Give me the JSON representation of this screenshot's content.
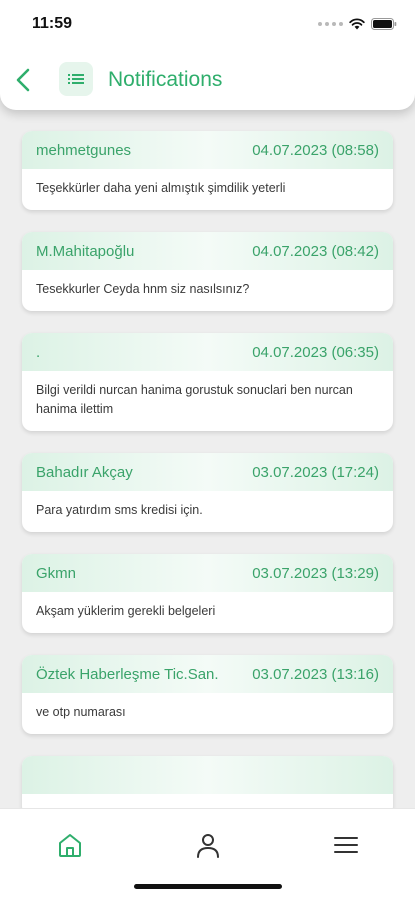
{
  "status_bar": {
    "time": "11:59"
  },
  "header": {
    "title": "Notifications"
  },
  "notifications": [
    {
      "sender": "mehmetgunes",
      "date": "04.07.2023 (08:58)",
      "message": "Teşekkürler daha yeni almıştık şimdilik yeterli"
    },
    {
      "sender": "M.Mahitapoğlu",
      "date": "04.07.2023 (08:42)",
      "message": "Tesekkurler Ceyda hnm siz nasılsınız?"
    },
    {
      "sender": ".",
      "date": "04.07.2023 (06:35)",
      "message": "Bilgi verildi nurcan hanima gorustuk sonuclari ben nurcan hanima ilettim"
    },
    {
      "sender": "Bahadır Akçay",
      "date": "03.07.2023 (17:24)",
      "message": "Para yatırdım sms kredisi için."
    },
    {
      "sender": "Gkmn",
      "date": "03.07.2023 (13:29)",
      "message": "Akşam yüklerim gerekli belgeleri"
    },
    {
      "sender": "Öztek Haberleşme Tic.San.",
      "date": "03.07.2023 (13:16)",
      "message": "ve otp numarası"
    },
    {
      "sender": "",
      "date": "",
      "message": ""
    }
  ],
  "nav": {
    "active": "home"
  },
  "colors": {
    "accent": "#2fae6c",
    "card_header": "#dcf2e5"
  },
  "icons": {
    "back": "chevron-left-icon",
    "menu": "list-icon",
    "home": "home-icon",
    "profile": "user-icon",
    "more": "hamburger-icon"
  }
}
